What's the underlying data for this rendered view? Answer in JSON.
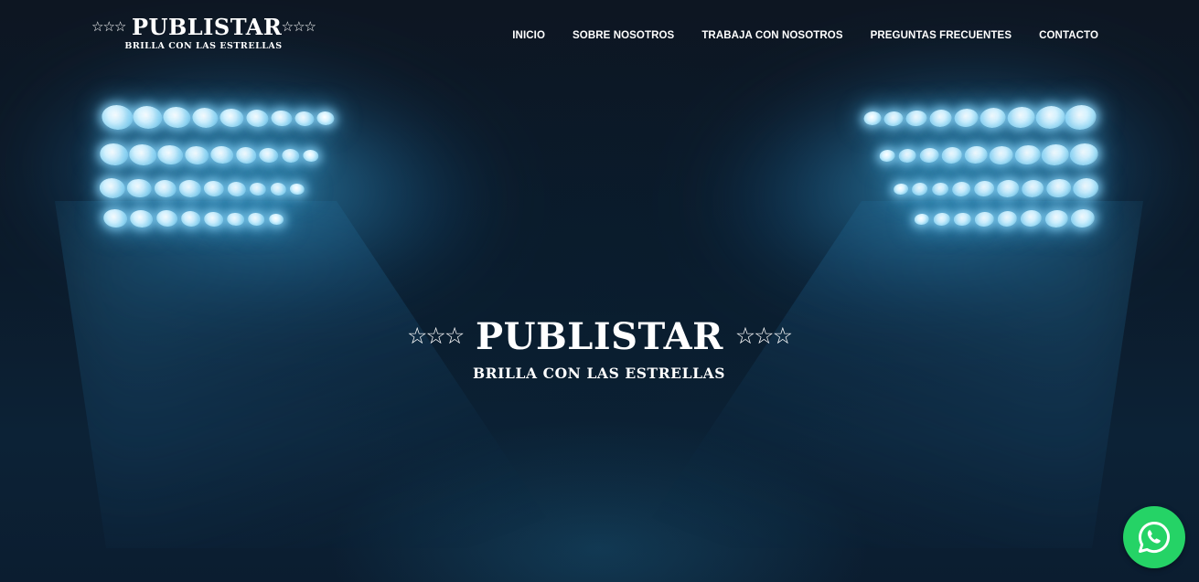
{
  "header": {
    "logo": {
      "stars_left": "☆☆☆",
      "brand": "PUBLISTAR",
      "stars_right": "☆☆☆",
      "tagline": "BRILLA CON LAS ESTRELLAS"
    },
    "nav": [
      {
        "label": "INICIO"
      },
      {
        "label": "SOBRE NOSOTROS"
      },
      {
        "label": "TRABAJA CON NOSOTROS"
      },
      {
        "label": "PREGUNTAS FRECUENTES"
      },
      {
        "label": "CONTACTO"
      }
    ]
  },
  "hero": {
    "logo": {
      "stars_left": "☆☆☆",
      "brand": "PUBLISTAR",
      "stars_right": "☆☆☆",
      "tagline": "BRILLA CON LAS ESTRELLAS"
    },
    "background": "stadium floodlights"
  },
  "whatsapp_button": {
    "icon": "whatsapp-icon",
    "color": "#25d366"
  },
  "colors": {
    "nav_text": "#ffffff",
    "beam_blue": "#3ca9dc",
    "background": "#0c1626"
  }
}
